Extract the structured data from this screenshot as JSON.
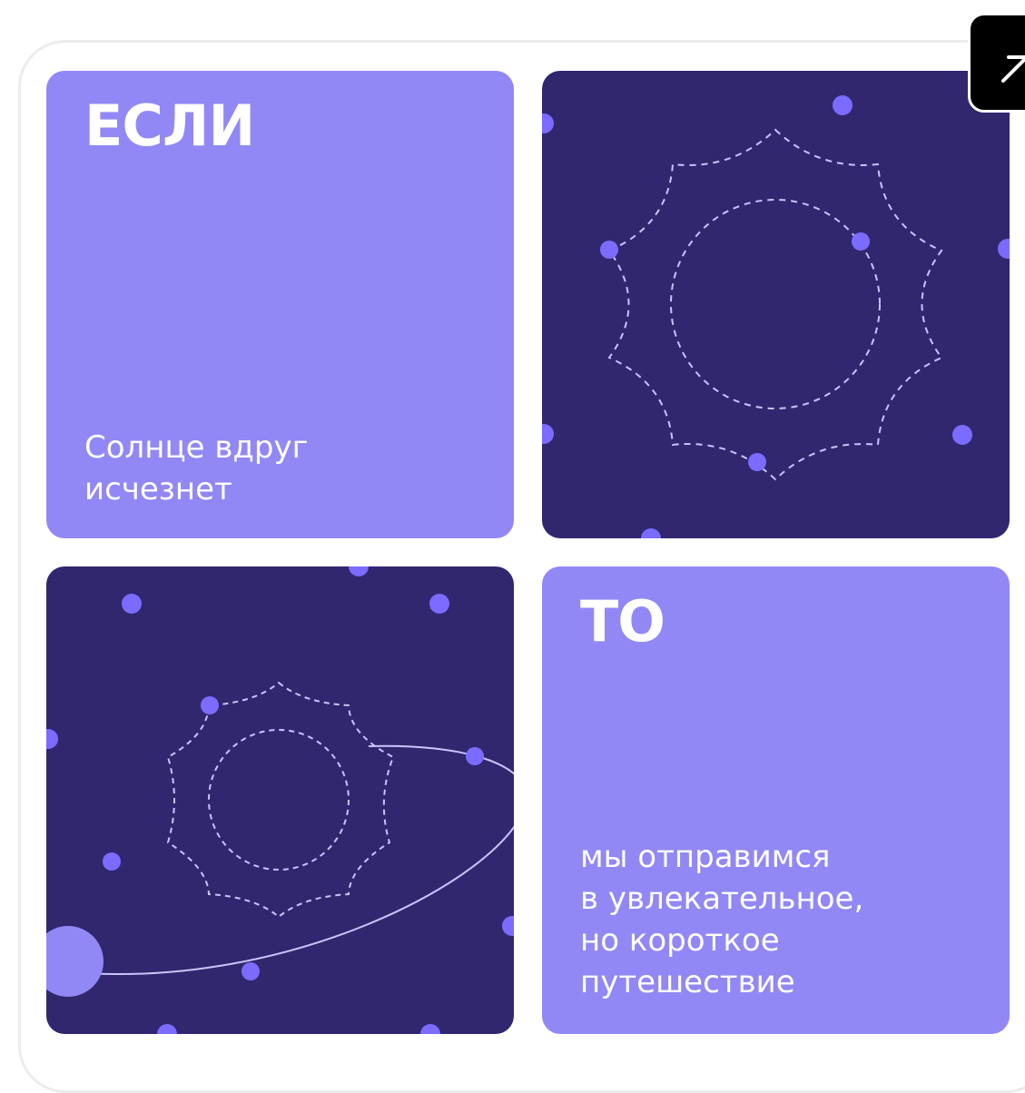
{
  "card": {
    "if_tile": {
      "heading": "ЕСЛИ",
      "caption": "Солнце вдруг\nисчезнет"
    },
    "then_tile": {
      "heading": "ТО",
      "caption": "мы отправимся\nв увлекательное,\nно короткое\nпутешествие"
    }
  },
  "controls": {
    "expand_icon": "arrow-up-right-icon"
  },
  "colors": {
    "light_tile": "#9188f5",
    "dark_tile": "#30276f",
    "dot": "#7b6bff",
    "dashed_line": "#c9c4ff"
  }
}
